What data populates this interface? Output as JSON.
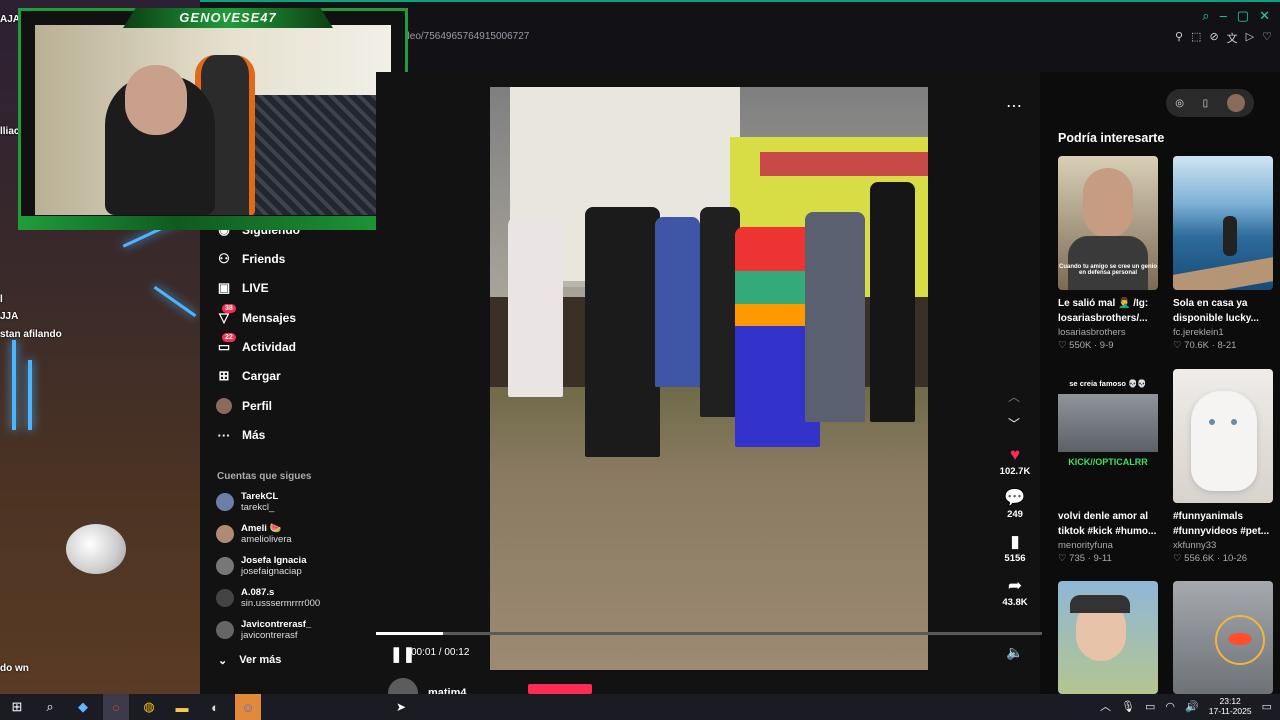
{
  "browser": {
    "url_fragment": "ideo/7564965764915006727"
  },
  "stream": {
    "banner": "GENOVESE47",
    "chat_fragments": [
      "AJA..",
      "lliaca",
      "l",
      "JJA",
      "stan afilando",
      "do wn"
    ]
  },
  "sidebar": {
    "items": [
      {
        "label": "Siguiendo",
        "icon": "people-icon"
      },
      {
        "label": "Friends",
        "icon": "friends-icon"
      },
      {
        "label": "LIVE",
        "icon": "live-icon"
      },
      {
        "label": "Mensajes",
        "icon": "messages-icon",
        "badge": "38"
      },
      {
        "label": "Actividad",
        "icon": "activity-icon",
        "badge": "22"
      },
      {
        "label": "Cargar",
        "icon": "upload-icon"
      },
      {
        "label": "Perfil",
        "icon": "profile-icon"
      },
      {
        "label": "Más",
        "icon": "more-icon"
      }
    ],
    "following_title": "Cuentas que sigues",
    "accounts": [
      {
        "name": "TarekCL",
        "handle": "tarekcl_"
      },
      {
        "name": "Ameli 🍉",
        "handle": "ameliolivera"
      },
      {
        "name": "Josefa Ignacia",
        "handle": "josefaignaciap"
      },
      {
        "name": "A.087.s",
        "handle": "sin.usssermrrrr000"
      },
      {
        "name": "Javicontrerasf_",
        "handle": "javicontrerasf"
      }
    ],
    "see_more": "Ver más"
  },
  "player": {
    "time": "00:01 / 00:12",
    "progress": 0.1,
    "author": "matim4",
    "actions": [
      {
        "icon": "heart-icon",
        "count": "102.7K",
        "color": "#fe2c55"
      },
      {
        "icon": "comment-icon",
        "count": "249"
      },
      {
        "icon": "bookmark-icon",
        "count": "5156"
      },
      {
        "icon": "share-icon",
        "count": "43.8K"
      }
    ]
  },
  "recommendations": {
    "title": "Podría interesarte",
    "items": [
      {
        "caption": "Le salió mal 🤦‍♂️ /Ig: losariasbrothers/...",
        "author": "losariasbrothers",
        "likes": "550K",
        "date": "9-9",
        "thumb_text": "Cuando tu amigo se cree un genio en defensa personal"
      },
      {
        "caption": "Sola en casa ya disponible lucky...",
        "author": "fc.jereklein1",
        "likes": "70.6K",
        "date": "8-21",
        "thumb_text": ""
      },
      {
        "caption": "volvi denle amor al tiktok #kick #humo...",
        "author": "menorityfuna",
        "likes": "735",
        "date": "9-11",
        "thumb_text": "se creia famoso 💀💀",
        "thumb_text2": "KICK//OPTICALRR"
      },
      {
        "caption": "#funnyanimals #funnyvideos #pet...",
        "author": "xkfunny33",
        "likes": "556.6K",
        "date": "10-26",
        "thumb_text": ""
      },
      {
        "caption": "",
        "author": "",
        "likes": "",
        "date": "",
        "thumb_text": ""
      },
      {
        "caption": "",
        "author": "",
        "likes": "",
        "date": "",
        "thumb_text": ""
      }
    ]
  },
  "taskbar": {
    "time": "23:12",
    "date": "17-11-2025"
  }
}
